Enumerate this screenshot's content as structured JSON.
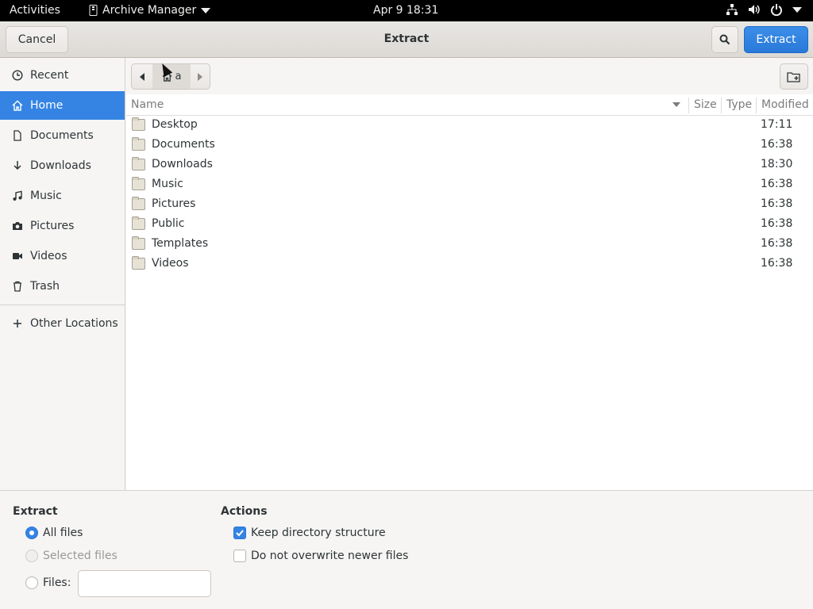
{
  "topbar": {
    "activities": "Activities",
    "app_name": "Archive Manager",
    "clock": "Apr 9  18:31",
    "tray_icons": [
      "network-icon",
      "volume-icon",
      "power-icon",
      "chevron-down-icon"
    ]
  },
  "header": {
    "title": "Extract",
    "cancel_label": "Cancel",
    "extract_label": "Extract",
    "accent": "#3584e4"
  },
  "sidebar": {
    "items": [
      {
        "label": "Recent",
        "icon": "clock-icon"
      },
      {
        "label": "Home",
        "icon": "home-icon",
        "active": true
      },
      {
        "label": "Documents",
        "icon": "document-icon"
      },
      {
        "label": "Downloads",
        "icon": "download-icon"
      },
      {
        "label": "Music",
        "icon": "music-icon"
      },
      {
        "label": "Pictures",
        "icon": "camera-icon"
      },
      {
        "label": "Videos",
        "icon": "video-icon"
      },
      {
        "label": "Trash",
        "icon": "trash-icon"
      }
    ],
    "other_locations": "Other Locations"
  },
  "pathbar": {
    "current": "a"
  },
  "columns": {
    "name": "Name",
    "size": "Size",
    "type": "Type",
    "modified": "Modified"
  },
  "files": [
    {
      "name": "Desktop",
      "modified": "17:11"
    },
    {
      "name": "Documents",
      "modified": "16:38"
    },
    {
      "name": "Downloads",
      "modified": "18:30"
    },
    {
      "name": "Music",
      "modified": "16:38"
    },
    {
      "name": "Pictures",
      "modified": "16:38"
    },
    {
      "name": "Public",
      "modified": "16:38"
    },
    {
      "name": "Templates",
      "modified": "16:38"
    },
    {
      "name": "Videos",
      "modified": "16:38"
    }
  ],
  "options": {
    "extract_title": "Extract",
    "all_files": "All files",
    "selected_files": "Selected files",
    "files": "Files:",
    "files_value": "",
    "actions_title": "Actions",
    "keep_structure": "Keep directory structure",
    "no_overwrite": "Do not overwrite newer files"
  }
}
